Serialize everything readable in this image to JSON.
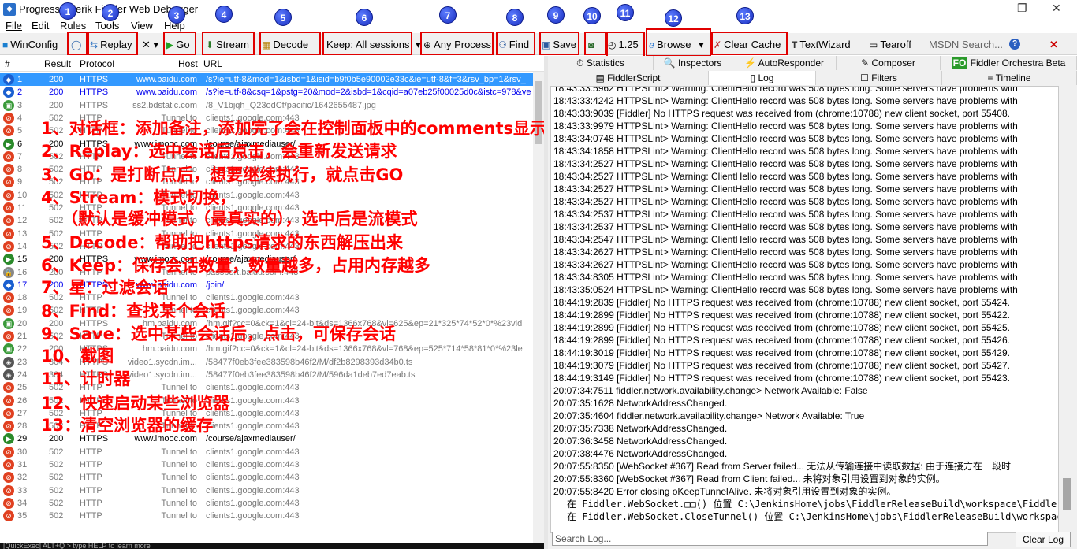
{
  "window": {
    "title": "Progress Telerik Fiddler Web Debugger",
    "min": "—",
    "max": "❐",
    "close": "✕"
  },
  "menu": [
    "File",
    "Edit",
    "Rules",
    "Tools",
    "View",
    "Help"
  ],
  "toolbar": {
    "winconfig": "WinConfig",
    "replay": "Replay",
    "remove": "✕",
    "go": "Go",
    "stream": "Stream",
    "decode": "Decode",
    "keep": "Keep: All sessions",
    "any_process": "Any Process",
    "find": "Find",
    "save": "Save",
    "timer": "1.25",
    "browse": "Browse",
    "clear_cache": "Clear Cache",
    "textwizard": "TextWizard",
    "tearoff": "Tearoff",
    "msdn": "MSDN Search...",
    "help": "?",
    "close": "✕"
  },
  "badges": [
    "1",
    "2",
    "3",
    "4",
    "5",
    "6",
    "7",
    "8",
    "9",
    "10",
    "11",
    "12",
    "13"
  ],
  "session_columns": {
    "num": "#",
    "result": "Result",
    "protocol": "Protocol",
    "host": "Host",
    "url": "URL"
  },
  "sessions": [
    {
      "n": "1",
      "r": "200",
      "p": "HTTPS",
      "h": "www.baidu.com",
      "u": "/s?ie=utf-8&mod=1&isbd=1&isid=b9f0b5e90002e33c&ie=utf-8&f=3&rsv_bp=1&rsv_",
      "cls": "sel",
      "icon": "◆",
      "ic": "#1a5fd0"
    },
    {
      "n": "2",
      "r": "200",
      "p": "HTTPS",
      "h": "www.baidu.com",
      "u": "/s?ie=utf-8&csq=1&pstg=20&mod=2&isbd=1&cqid=a07eb25f00025d0c&istc=978&ve",
      "cls": "blue",
      "icon": "◆",
      "ic": "#1a5fd0"
    },
    {
      "n": "3",
      "r": "200",
      "p": "HTTPS",
      "h": "ss2.bdstatic.com",
      "u": "/8_V1bjqh_Q23odCf/pacific/1642655487.jpg",
      "cls": "gray",
      "icon": "▣",
      "ic": "#3a9a3a"
    },
    {
      "n": "4",
      "r": "502",
      "p": "HTTP",
      "h": "Tunnel to",
      "u": "clients1.google.com:443",
      "cls": "gray",
      "icon": "⊘",
      "ic": "#e04020"
    },
    {
      "n": "5",
      "r": "502",
      "p": "HTTP",
      "h": "Tunnel to",
      "u": "clients1.google.com:443",
      "cls": "gray",
      "icon": "⊘",
      "ic": "#e04020"
    },
    {
      "n": "6",
      "r": "200",
      "p": "HTTPS",
      "h": "www.imooc.com",
      "u": "/course/ajaxmediauser/",
      "cls": "black",
      "icon": "▶",
      "ic": "#2a8a2a"
    },
    {
      "n": "7",
      "r": "502",
      "p": "HTTP",
      "h": "Tunnel to",
      "u": "clients1.google.com:443",
      "cls": "gray",
      "icon": "⊘",
      "ic": "#e04020"
    },
    {
      "n": "8",
      "r": "502",
      "p": "HTTP",
      "h": "Tunnel to",
      "u": "clients1.google.com:443",
      "cls": "gray",
      "icon": "⊘",
      "ic": "#e04020"
    },
    {
      "n": "9",
      "r": "502",
      "p": "HTTP",
      "h": "Tunnel to",
      "u": "clients1.google.com:443",
      "cls": "gray",
      "icon": "⊘",
      "ic": "#e04020"
    },
    {
      "n": "10",
      "r": "502",
      "p": "HTTP",
      "h": "Tunnel to",
      "u": "clients1.google.com:443",
      "cls": "gray",
      "icon": "⊘",
      "ic": "#e04020"
    },
    {
      "n": "11",
      "r": "502",
      "p": "HTTP",
      "h": "Tunnel to",
      "u": "clients1.google.com:443",
      "cls": "gray",
      "icon": "⊘",
      "ic": "#e04020"
    },
    {
      "n": "12",
      "r": "502",
      "p": "HTTP",
      "h": "Tunnel to",
      "u": "clients1.google.com:443",
      "cls": "gray",
      "icon": "⊘",
      "ic": "#e04020"
    },
    {
      "n": "13",
      "r": "502",
      "p": "HTTP",
      "h": "Tunnel to",
      "u": "clients1.google.com:443",
      "cls": "gray",
      "icon": "⊘",
      "ic": "#e04020"
    },
    {
      "n": "14",
      "r": "502",
      "p": "HTTP",
      "h": "Tunnel to",
      "u": "clients1.google.com:443",
      "cls": "gray",
      "icon": "⊘",
      "ic": "#e04020"
    },
    {
      "n": "15",
      "r": "200",
      "p": "HTTPS",
      "h": "www.imooc.com",
      "u": "/course/ajaxmediauser/",
      "cls": "black",
      "icon": "▶",
      "ic": "#2a8a2a"
    },
    {
      "n": "16",
      "r": "200",
      "p": "HTTP",
      "h": "Tunnel to",
      "u": "passport.baidu.com:443",
      "cls": "gray",
      "icon": "🔒",
      "ic": "#888"
    },
    {
      "n": "17",
      "r": "200",
      "p": "HTTPS",
      "h": "www.baidu.com",
      "u": "/join/",
      "cls": "blue",
      "icon": "◆",
      "ic": "#1a5fd0"
    },
    {
      "n": "18",
      "r": "502",
      "p": "HTTP",
      "h": "Tunnel to",
      "u": "clients1.google.com:443",
      "cls": "gray",
      "icon": "⊘",
      "ic": "#e04020"
    },
    {
      "n": "19",
      "r": "502",
      "p": "HTTP",
      "h": "Tunnel to",
      "u": "clients1.google.com:443",
      "cls": "gray",
      "icon": "⊘",
      "ic": "#e04020"
    },
    {
      "n": "20",
      "r": "200",
      "p": "HTTPS",
      "h": "hm.baidu.com",
      "u": "/hm.gif?cc=0&ck=1&cl=24-bit&ds=1366x768&vl=625&ep=21*325*74*52*0*%23vid",
      "cls": "gray",
      "icon": "▣",
      "ic": "#3a9a3a"
    },
    {
      "n": "21",
      "r": "502",
      "p": "HTTP",
      "h": "Tunnel to",
      "u": "clients1.google.com:443",
      "cls": "gray",
      "icon": "⊘",
      "ic": "#e04020"
    },
    {
      "n": "22",
      "r": "200",
      "p": "HTTPS",
      "h": "hm.baidu.com",
      "u": "/hm.gif?cc=0&ck=1&cl=24-bit&ds=1366x768&vl=768&ep=525*714*58*81*0*%23le",
      "cls": "gray",
      "icon": "▣",
      "ic": "#3a9a3a"
    },
    {
      "n": "23",
      "r": "304",
      "p": "HTTPS",
      "h": "video1.sycdn.im...",
      "u": "/58477f0eb3fee383598b46f2/M/df2b8298393d34b0.ts",
      "cls": "gray",
      "icon": "◈",
      "ic": "#555"
    },
    {
      "n": "24",
      "r": "304",
      "p": "HTTPS",
      "h": "video1.sycdn.im...",
      "u": "/58477f0eb3fee383598b46f2/M/596da1deb7ed7eab.ts",
      "cls": "gray",
      "icon": "◈",
      "ic": "#555"
    },
    {
      "n": "25",
      "r": "502",
      "p": "HTTP",
      "h": "Tunnel to",
      "u": "clients1.google.com:443",
      "cls": "gray",
      "icon": "⊘",
      "ic": "#e04020"
    },
    {
      "n": "26",
      "r": "502",
      "p": "HTTP",
      "h": "Tunnel to",
      "u": "clients1.google.com:443",
      "cls": "gray",
      "icon": "⊘",
      "ic": "#e04020"
    },
    {
      "n": "27",
      "r": "502",
      "p": "HTTP",
      "h": "Tunnel to",
      "u": "clients1.google.com:443",
      "cls": "gray",
      "icon": "⊘",
      "ic": "#e04020"
    },
    {
      "n": "28",
      "r": "502",
      "p": "HTTP",
      "h": "Tunnel to",
      "u": "clients1.google.com:443",
      "cls": "gray",
      "icon": "⊘",
      "ic": "#e04020"
    },
    {
      "n": "29",
      "r": "200",
      "p": "HTTPS",
      "h": "www.imooc.com",
      "u": "/course/ajaxmediauser/",
      "cls": "black",
      "icon": "▶",
      "ic": "#2a8a2a"
    },
    {
      "n": "30",
      "r": "502",
      "p": "HTTP",
      "h": "Tunnel to",
      "u": "clients1.google.com:443",
      "cls": "gray",
      "icon": "⊘",
      "ic": "#e04020"
    },
    {
      "n": "31",
      "r": "502",
      "p": "HTTP",
      "h": "Tunnel to",
      "u": "clients1.google.com:443",
      "cls": "gray",
      "icon": "⊘",
      "ic": "#e04020"
    },
    {
      "n": "32",
      "r": "502",
      "p": "HTTP",
      "h": "Tunnel to",
      "u": "clients1.google.com:443",
      "cls": "gray",
      "icon": "⊘",
      "ic": "#e04020"
    },
    {
      "n": "33",
      "r": "502",
      "p": "HTTP",
      "h": "Tunnel to",
      "u": "clients1.google.com:443",
      "cls": "gray",
      "icon": "⊘",
      "ic": "#e04020"
    },
    {
      "n": "34",
      "r": "502",
      "p": "HTTP",
      "h": "Tunnel to",
      "u": "clients1.google.com:443",
      "cls": "gray",
      "icon": "⊘",
      "ic": "#e04020"
    },
    {
      "n": "35",
      "r": "502",
      "p": "HTTP",
      "h": "Tunnel to",
      "u": "clients1.google.com:443",
      "cls": "gray",
      "icon": "⊘",
      "ic": "#e04020"
    }
  ],
  "status_bar": "[QuickExec] ALT+Q > type HELP to learn more",
  "notes": [
    "1、对话框：添加备注，添加完了会在控制面板中的comments显示",
    "2、Replay：选中会话后点击，会重新发送请求",
    "3、Go：是打断点后，想要继续执行，就点击GO",
    "4、Stream：模式切换，",
    "（默认是缓冲模式（最真实的），选中后是流模式",
    "5、Decode：帮助把https请求的东西解压出来",
    "6、Keep：保存会话数量，数量越多，占用内存越多",
    "7、星：过滤会话",
    "8、Find：查找某个会话",
    "9、Save：选中某些会话后，点击，可保存会话",
    "10、截图",
    "11、计时器",
    "12、快速启动某些浏览器",
    "13：清空浏览器的缓存"
  ],
  "tabs_row1": [
    {
      "label": "Statistics",
      "icon": "⏱"
    },
    {
      "label": "Inspectors",
      "icon": "🔍"
    },
    {
      "label": "AutoResponder",
      "icon": "⚡"
    },
    {
      "label": "Composer",
      "icon": "✎"
    },
    {
      "label": "Fiddler Orchestra Beta",
      "icon": "FO"
    }
  ],
  "tabs_row2": [
    {
      "label": "FiddlerScript",
      "icon": "▤"
    },
    {
      "label": "Log",
      "icon": "▯"
    },
    {
      "label": "Filters",
      "icon": "☐"
    },
    {
      "label": "Timeline",
      "icon": "≡"
    }
  ],
  "log": [
    "18:43:33:5962 HTTPSLint> Warning: ClientHello record was 508 bytes long. Some servers have problems with",
    "18:43:33:4242 HTTPSLint> Warning: ClientHello record was 508 bytes long. Some servers have problems with",
    "18:43:33:9039 [Fiddler] No HTTPS request was received from (chrome:10788) new client socket, port 55408.",
    "18:43:33:9979 HTTPSLint> Warning: ClientHello record was 508 bytes long. Some servers have problems with",
    "18:43:34:0748 HTTPSLint> Warning: ClientHello record was 508 bytes long. Some servers have problems with",
    "18:43:34:1858 HTTPSLint> Warning: ClientHello record was 508 bytes long. Some servers have problems with",
    "18:43:34:2527 HTTPSLint> Warning: ClientHello record was 508 bytes long. Some servers have problems with",
    "18:43:34:2527 HTTPSLint> Warning: ClientHello record was 508 bytes long. Some servers have problems with",
    "18:43:34:2527 HTTPSLint> Warning: ClientHello record was 508 bytes long. Some servers have problems with",
    "18:43:34:2527 HTTPSLint> Warning: ClientHello record was 508 bytes long. Some servers have problems with",
    "18:43:34:2537 HTTPSLint> Warning: ClientHello record was 508 bytes long. Some servers have problems with",
    "18:43:34:2537 HTTPSLint> Warning: ClientHello record was 508 bytes long. Some servers have problems with",
    "18:43:34:2547 HTTPSLint> Warning: ClientHello record was 508 bytes long. Some servers have problems with",
    "18:43:34:2627 HTTPSLint> Warning: ClientHello record was 508 bytes long. Some servers have problems with",
    "18:43:34:2627 HTTPSLint> Warning: ClientHello record was 508 bytes long. Some servers have problems with",
    "18:43:34:8305 HTTPSLint> Warning: ClientHello record was 508 bytes long. Some servers have problems with",
    "18:43:35:0524 HTTPSLint> Warning: ClientHello record was 508 bytes long. Some servers have problems with",
    "18:44:19:2839 [Fiddler] No HTTPS request was received from (chrome:10788) new client socket, port 55424.",
    "18:44:19:2899 [Fiddler] No HTTPS request was received from (chrome:10788) new client socket, port 55422.",
    "18:44:19:2899 [Fiddler] No HTTPS request was received from (chrome:10788) new client socket, port 55425.",
    "18:44:19:2899 [Fiddler] No HTTPS request was received from (chrome:10788) new client socket, port 55426.",
    "18:44:19:3019 [Fiddler] No HTTPS request was received from (chrome:10788) new client socket, port 55429.",
    "18:44:19:3079 [Fiddler] No HTTPS request was received from (chrome:10788) new client socket, port 55427.",
    "18:44:19:3149 [Fiddler] No HTTPS request was received from (chrome:10788) new client socket, port 55423.",
    "20:07:34:7511 fiddler.network.availability.change> Network Available: False",
    "20:07:35:1628 NetworkAddressChanged.",
    "20:07:35:4604 fiddler.network.availability.change> Network Available: True",
    "20:07:35:7338 NetworkAddressChanged.",
    "20:07:36:3458 NetworkAddressChanged.",
    "20:07:38:4476 NetworkAddressChanged.",
    "20:07:55:8350 [WebSocket #367] Read from Server failed... 无法从传输连接中读取数据: 由于连接方在一段时",
    "20:07:55:8360 [WebSocket #367] Read from Client failed... 未将对象引用设置到对象的实例。",
    "20:07:55:8420 Error closing oKeepTunnelAlive. 未将对象引用设置到对象的实例。",
    "   在 Fiddler.WebSocket.□□() 位置 C:\\JenkinsHome\\jobs\\FiddlerReleaseBuild\\workspace\\Fiddle:",
    "   在 Fiddler.WebSocket.CloseTunnel() 位置 C:\\JenkinsHome\\jobs\\FiddlerReleaseBuild\\workspace"
  ],
  "search_placeholder": "Search Log...",
  "clear_log": "Clear Log"
}
